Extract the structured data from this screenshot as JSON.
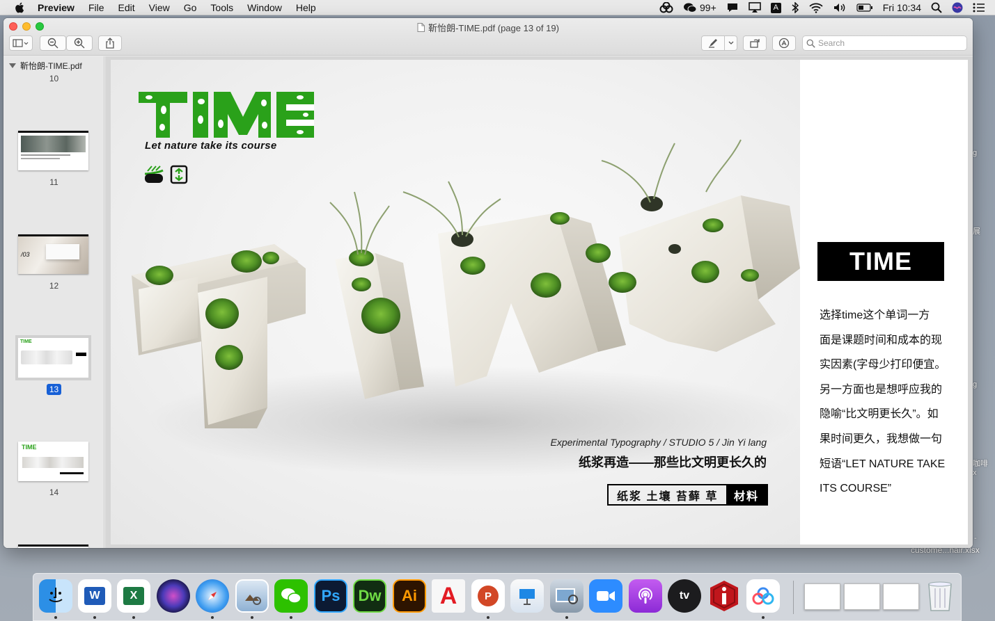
{
  "menubar": {
    "app_name": "Preview",
    "items": [
      "File",
      "Edit",
      "View",
      "Go",
      "Tools",
      "Window",
      "Help"
    ],
    "status": {
      "badge_count": "99+",
      "input_letter": "A",
      "clock": "Fri 10:34"
    }
  },
  "desktop": {
    "labels": [
      "g",
      "展",
      "g",
      "咖啡",
      "x",
      "-",
      "custome...hair.xlsx"
    ]
  },
  "window": {
    "title": "靳怡朗-TIME.pdf (page 13 of 19)",
    "search_placeholder": "Search"
  },
  "sidebar": {
    "file_name": "靳怡朗-TIME.pdf",
    "pages": [
      {
        "num": "10"
      },
      {
        "num": "11"
      },
      {
        "num": "12"
      },
      {
        "num": "13",
        "selected": true
      },
      {
        "num": "14"
      }
    ]
  },
  "page": {
    "logo_word": "TIME",
    "logo_tagline": "Let nature take its course",
    "caption_en": "Experimental Typography / STUDIO 5 / Jin Yi lang",
    "caption_cn": "纸浆再造——那些比文明更长久的",
    "tag_words": "纸浆 土壤 苔藓 草",
    "tag_material": "材料",
    "panel_title": "TIME",
    "panel_lines": [
      "选择time这个单词一方",
      "面是课题时间和成本的现",
      "实因素(字母少打印便宜。",
      "另一方面也是想呼应我的",
      "隐喻“比文明更长久”。如",
      "果时间更久，我想做一句",
      "短语“LET NATURE TAKE",
      "ITS COURSE”"
    ],
    "accent_green": "#2aa11a"
  },
  "dock": {
    "apps": [
      "Finder",
      "Word",
      "Excel",
      "Siri",
      "Safari",
      "Preview",
      "WeChat",
      "Ps",
      "Dw",
      "Ai",
      "Acrobat",
      "PowerPoint",
      "Keynote",
      "Image Capture",
      "Zoom",
      "Podcasts",
      "tv",
      "Info",
      "Baidu Netdisk"
    ]
  }
}
